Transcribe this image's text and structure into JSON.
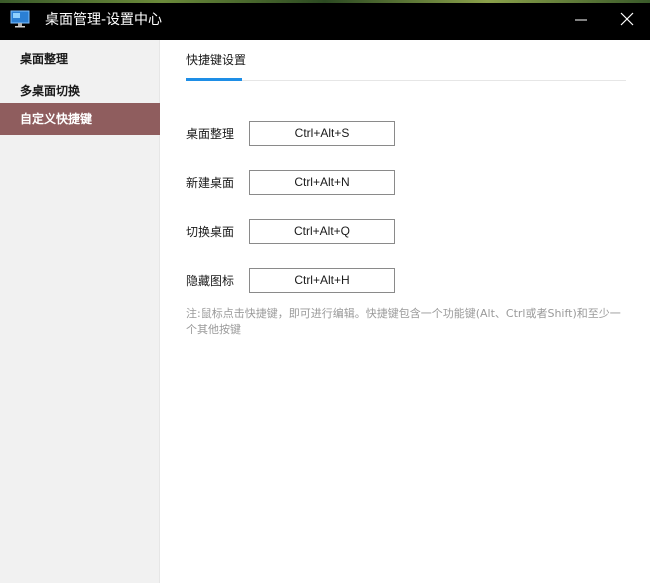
{
  "window": {
    "title": "桌面管理-设置中心",
    "icons": {
      "app": "monitor-icon",
      "minimize": "minimize-icon",
      "close": "close-icon"
    }
  },
  "sidebar": {
    "items": [
      {
        "label": "桌面整理",
        "active": false
      },
      {
        "label": "多桌面切换",
        "active": false
      },
      {
        "label": "自定义快捷键",
        "active": true
      }
    ]
  },
  "main": {
    "tab": "快捷键设置",
    "shortcuts": [
      {
        "label": "桌面整理",
        "value": "Ctrl+Alt+S"
      },
      {
        "label": "新建桌面",
        "value": "Ctrl+Alt+N"
      },
      {
        "label": "切换桌面",
        "value": "Ctrl+Alt+Q"
      },
      {
        "label": "隐藏图标",
        "value": "Ctrl+Alt+H"
      }
    ],
    "note_line1": "注:鼠标点击快捷键，即可进行编辑。快捷键包含一个功能键(Alt、Ctrl或者Shift)和至少一",
    "note_line2": "个其他按键"
  },
  "colors": {
    "titlebar": "#000000",
    "sidebar_bg": "#f1f1f1",
    "sidebar_active": "#8f5d5e",
    "tab_accent": "#1e8ee6",
    "note_text": "#9a9a9a"
  }
}
